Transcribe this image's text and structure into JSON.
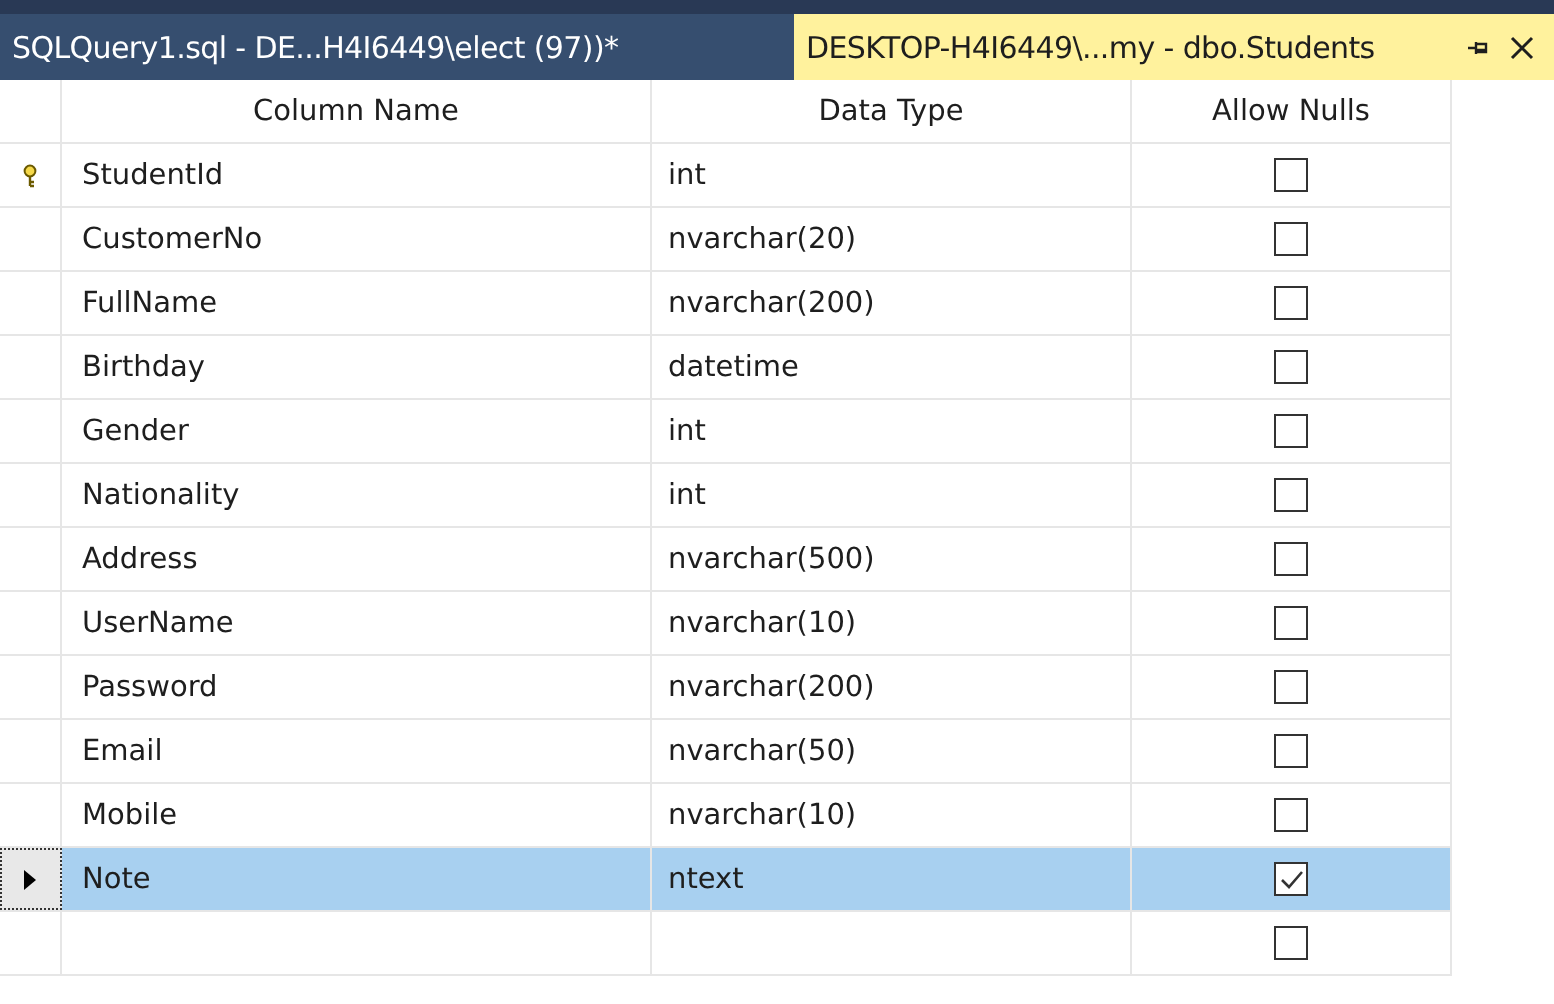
{
  "tabs": [
    {
      "title": "SQLQuery1.sql - DE...H4I6449\\elect (97))*",
      "selected": false
    },
    {
      "title": "DESKTOP-H4I6449\\...my - dbo.Students",
      "selected": true
    }
  ],
  "table": {
    "columns": [
      "Column Name",
      "Data Type",
      "Allow Nulls"
    ],
    "rows": [
      {
        "kind": "field",
        "name": "StudentId",
        "type": "int",
        "allow_nulls": false,
        "primary_key": true,
        "selected": false
      },
      {
        "kind": "field",
        "name": "CustomerNo",
        "type": "nvarchar(20)",
        "allow_nulls": false,
        "primary_key": false,
        "selected": false
      },
      {
        "kind": "field",
        "name": "FullName",
        "type": "nvarchar(200)",
        "allow_nulls": false,
        "primary_key": false,
        "selected": false
      },
      {
        "kind": "field",
        "name": "Birthday",
        "type": "datetime",
        "allow_nulls": false,
        "primary_key": false,
        "selected": false
      },
      {
        "kind": "field",
        "name": "Gender",
        "type": "int",
        "allow_nulls": false,
        "primary_key": false,
        "selected": false
      },
      {
        "kind": "field",
        "name": "Nationality",
        "type": "int",
        "allow_nulls": false,
        "primary_key": false,
        "selected": false
      },
      {
        "kind": "field",
        "name": "Address",
        "type": "nvarchar(500)",
        "allow_nulls": false,
        "primary_key": false,
        "selected": false
      },
      {
        "kind": "field",
        "name": "UserName",
        "type": "nvarchar(10)",
        "allow_nulls": false,
        "primary_key": false,
        "selected": false
      },
      {
        "kind": "field",
        "name": "Password",
        "type": "nvarchar(200)",
        "allow_nulls": false,
        "primary_key": false,
        "selected": false
      },
      {
        "kind": "field",
        "name": "Email",
        "type": "nvarchar(50)",
        "allow_nulls": false,
        "primary_key": false,
        "selected": false
      },
      {
        "kind": "field",
        "name": "Mobile",
        "type": "nvarchar(10)",
        "allow_nulls": false,
        "primary_key": false,
        "selected": false
      },
      {
        "kind": "field",
        "name": "Note",
        "type": "ntext",
        "allow_nulls": true,
        "primary_key": false,
        "selected": true
      },
      {
        "kind": "new",
        "allow_nulls": false,
        "primary_key": false,
        "selected": false
      }
    ]
  }
}
